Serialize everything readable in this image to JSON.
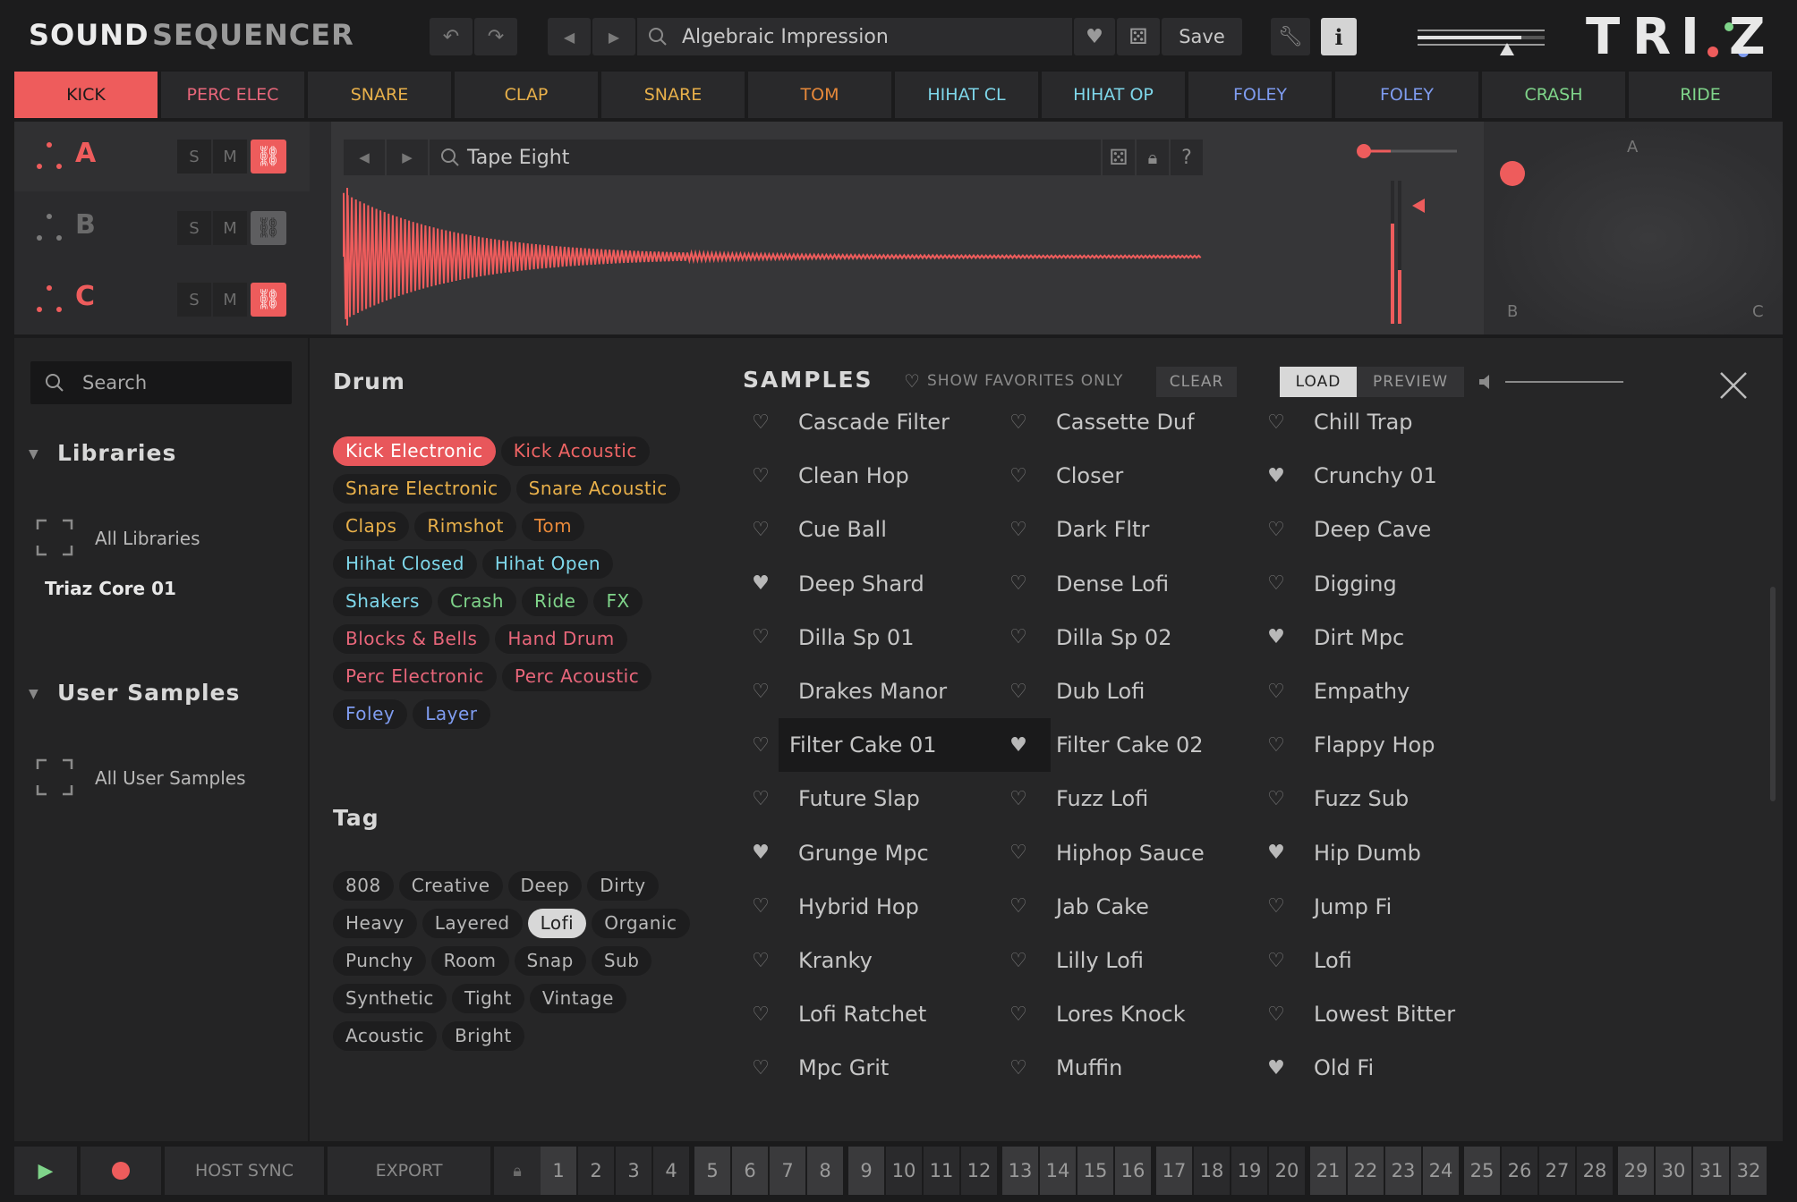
{
  "header": {
    "title_a": "SOUND",
    "title_b": "SEQUENCER",
    "preset_name": "Algebraic Impression",
    "save_label": "Save",
    "info_label": "i",
    "logo": "TRIAZ"
  },
  "tabs": [
    {
      "label": "KICK",
      "color": "#1a1a1a"
    },
    {
      "label": "PERC ELEC",
      "color": "#e8667a"
    },
    {
      "label": "SNARE",
      "color": "#e8b04a"
    },
    {
      "label": "CLAP",
      "color": "#e8b04a"
    },
    {
      "label": "SNARE",
      "color": "#e8b04a"
    },
    {
      "label": "TOM",
      "color": "#e8893a"
    },
    {
      "label": "HIHAT CL",
      "color": "#7ed7ea"
    },
    {
      "label": "HIHAT OP",
      "color": "#7ed7ea"
    },
    {
      "label": "FOLEY",
      "color": "#7f9cf0"
    },
    {
      "label": "FOLEY",
      "color": "#7f9cf0"
    },
    {
      "label": "CRASH",
      "color": "#7fd48a"
    },
    {
      "label": "RIDE",
      "color": "#7fd48a"
    }
  ],
  "layers": [
    {
      "letter": "A",
      "solo": "S",
      "mute": "M",
      "linked": true
    },
    {
      "letter": "B",
      "solo": "S",
      "mute": "M",
      "linked": false
    },
    {
      "letter": "C",
      "solo": "S",
      "mute": "M",
      "linked": true
    }
  ],
  "layer_sample": "Tape Eight",
  "xy_pad": {
    "a": "A",
    "b": "B",
    "c": "C"
  },
  "sidebar": {
    "search_placeholder": "Search",
    "libraries_label": "Libraries",
    "all_libraries": "All Libraries",
    "library_item": "Triaz Core 01",
    "user_samples_label": "User Samples",
    "all_user_samples": "All User Samples"
  },
  "drum": {
    "heading": "Drum",
    "chips": [
      {
        "label": "Kick Electronic",
        "color": "#ffffff",
        "bg": "#e8575b",
        "selected": true
      },
      {
        "label": "Kick Acoustic",
        "color": "#ee6464",
        "bg": "#1d1d1e"
      },
      {
        "label": "Snare Electronic",
        "color": "#e8b04a",
        "bg": "#1d1d1e"
      },
      {
        "label": "Snare Acoustic",
        "color": "#e8b04a",
        "bg": "#1d1d1e"
      },
      {
        "label": "Claps",
        "color": "#e8b04a",
        "bg": "#1d1d1e"
      },
      {
        "label": "Rimshot",
        "color": "#e8b04a",
        "bg": "#1d1d1e"
      },
      {
        "label": "Tom",
        "color": "#e8893a",
        "bg": "#1d1d1e"
      },
      {
        "label": "Hihat Closed",
        "color": "#7ed7ea",
        "bg": "#1d1d1e"
      },
      {
        "label": "Hihat Open",
        "color": "#7ed7ea",
        "bg": "#1d1d1e"
      },
      {
        "label": "Shakers",
        "color": "#7ed7ea",
        "bg": "#1d1d1e"
      },
      {
        "label": "Crash",
        "color": "#7fd48a",
        "bg": "#1d1d1e"
      },
      {
        "label": "Ride",
        "color": "#7fd48a",
        "bg": "#1d1d1e"
      },
      {
        "label": "FX",
        "color": "#7fd48a",
        "bg": "#1d1d1e"
      },
      {
        "label": "Blocks & Bells",
        "color": "#e8667a",
        "bg": "#1d1d1e"
      },
      {
        "label": "Hand Drum",
        "color": "#e8667a",
        "bg": "#1d1d1e"
      },
      {
        "label": "Perc Electronic",
        "color": "#e8667a",
        "bg": "#1d1d1e"
      },
      {
        "label": "Perc Acoustic",
        "color": "#e8667a",
        "bg": "#1d1d1e"
      },
      {
        "label": "Foley",
        "color": "#7f9cf0",
        "bg": "#1d1d1e"
      },
      {
        "label": "Layer",
        "color": "#7f9cf0",
        "bg": "#1d1d1e"
      }
    ]
  },
  "tag": {
    "heading": "Tag",
    "chips": [
      {
        "label": "808"
      },
      {
        "label": "Creative"
      },
      {
        "label": "Deep"
      },
      {
        "label": "Dirty"
      },
      {
        "label": "Heavy"
      },
      {
        "label": "Layered"
      },
      {
        "label": "Lofi",
        "selected": true
      },
      {
        "label": "Organic"
      },
      {
        "label": "Punchy"
      },
      {
        "label": "Room"
      },
      {
        "label": "Snap"
      },
      {
        "label": "Sub"
      },
      {
        "label": "Synthetic"
      },
      {
        "label": "Tight"
      },
      {
        "label": "Vintage"
      },
      {
        "label": "Acoustic"
      },
      {
        "label": "Bright"
      }
    ]
  },
  "samples": {
    "heading": "SAMPLES",
    "favorites_label": "SHOW FAVORITES ONLY",
    "clear_label": "CLEAR",
    "load_label": "LOAD",
    "preview_label": "PREVIEW",
    "columns": [
      [
        {
          "name": "Cascade Filter",
          "fav": false
        },
        {
          "name": "Clean Hop",
          "fav": false
        },
        {
          "name": "Cue Ball",
          "fav": false
        },
        {
          "name": "Deep Shard",
          "fav": true
        },
        {
          "name": "Dilla Sp 01",
          "fav": false
        },
        {
          "name": "Drakes Manor",
          "fav": false
        },
        {
          "name": "Filter Cake 01",
          "fav": false,
          "selected": true
        },
        {
          "name": "Future Slap",
          "fav": false
        },
        {
          "name": "Grunge Mpc",
          "fav": true
        },
        {
          "name": "Hybrid Hop",
          "fav": false
        },
        {
          "name": "Kranky",
          "fav": false
        },
        {
          "name": "Lofi Ratchet",
          "fav": false
        },
        {
          "name": "Mpc Grit",
          "fav": false
        }
      ],
      [
        {
          "name": "Cassette Duf",
          "fav": false
        },
        {
          "name": "Closer",
          "fav": false
        },
        {
          "name": "Dark Fltr",
          "fav": false
        },
        {
          "name": "Dense Lofi",
          "fav": false
        },
        {
          "name": "Dilla Sp 02",
          "fav": false
        },
        {
          "name": "Dub Lofi",
          "fav": false
        },
        {
          "name": "Filter Cake 02",
          "fav": true
        },
        {
          "name": "Fuzz Lofi",
          "fav": false
        },
        {
          "name": "Hiphop Sauce",
          "fav": false
        },
        {
          "name": "Jab Cake",
          "fav": false
        },
        {
          "name": "Lilly Lofi",
          "fav": false
        },
        {
          "name": "Lores Knock",
          "fav": false
        },
        {
          "name": "Muffin",
          "fav": false
        }
      ],
      [
        {
          "name": "Chill Trap",
          "fav": false
        },
        {
          "name": "Crunchy 01",
          "fav": true
        },
        {
          "name": "Deep Cave",
          "fav": false
        },
        {
          "name": "Digging",
          "fav": false
        },
        {
          "name": "Dirt Mpc",
          "fav": true
        },
        {
          "name": "Empathy",
          "fav": false
        },
        {
          "name": "Flappy Hop",
          "fav": false
        },
        {
          "name": "Fuzz Sub",
          "fav": false
        },
        {
          "name": "Hip Dumb",
          "fav": true
        },
        {
          "name": "Jump Fi",
          "fav": false
        },
        {
          "name": "Lofi",
          "fav": false
        },
        {
          "name": "Lowest Bitter",
          "fav": false
        },
        {
          "name": "Old Fi",
          "fav": true
        }
      ]
    ]
  },
  "transport": {
    "host_sync": "HOST SYNC",
    "export": "EXPORT",
    "steps": [
      "1",
      "2",
      "3",
      "4",
      "5",
      "6",
      "7",
      "8",
      "9",
      "10",
      "11",
      "12",
      "13",
      "14",
      "15",
      "16",
      "17",
      "18",
      "19",
      "20",
      "21",
      "22",
      "23",
      "24",
      "25",
      "26",
      "27",
      "28",
      "29",
      "30",
      "31",
      "32"
    ]
  },
  "colors": {
    "accent": "#ee5c5c"
  }
}
